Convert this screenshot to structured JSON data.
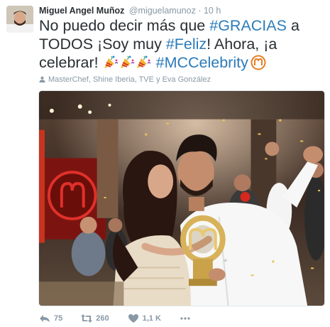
{
  "tweet": {
    "author_name": "Miguel Angel Muñoz",
    "handle": "@miguelamunoz",
    "separator": "·",
    "time": "10 h",
    "text": {
      "p1": "No puedo decir más que ",
      "tag1": "#GRACIAS",
      "p2": " a TODOS ¡Soy muy ",
      "tag2": "#Feliz",
      "p3": "! Ahora, ¡a celebrar! ",
      "tag3": "#MCCelebrity"
    },
    "tagged_people": "MasterChef, Shine Iberia, TVE y Eva González",
    "actions": {
      "reply_count": "75",
      "retweet_count": "260",
      "like_count": "1,1 K"
    }
  },
  "icons": {
    "reply": "reply-icon",
    "retweet": "retweet-icon",
    "like": "heart-icon",
    "more": "more-dots-icon",
    "party": "party-popper-icon",
    "masterchef": "masterchef-logo-icon",
    "tagged": "person-icon"
  },
  "colors": {
    "hashtag": "#2b7bb9",
    "meta": "#8899a6",
    "text": "#292f33",
    "masterchef_red": "#d6281c"
  }
}
